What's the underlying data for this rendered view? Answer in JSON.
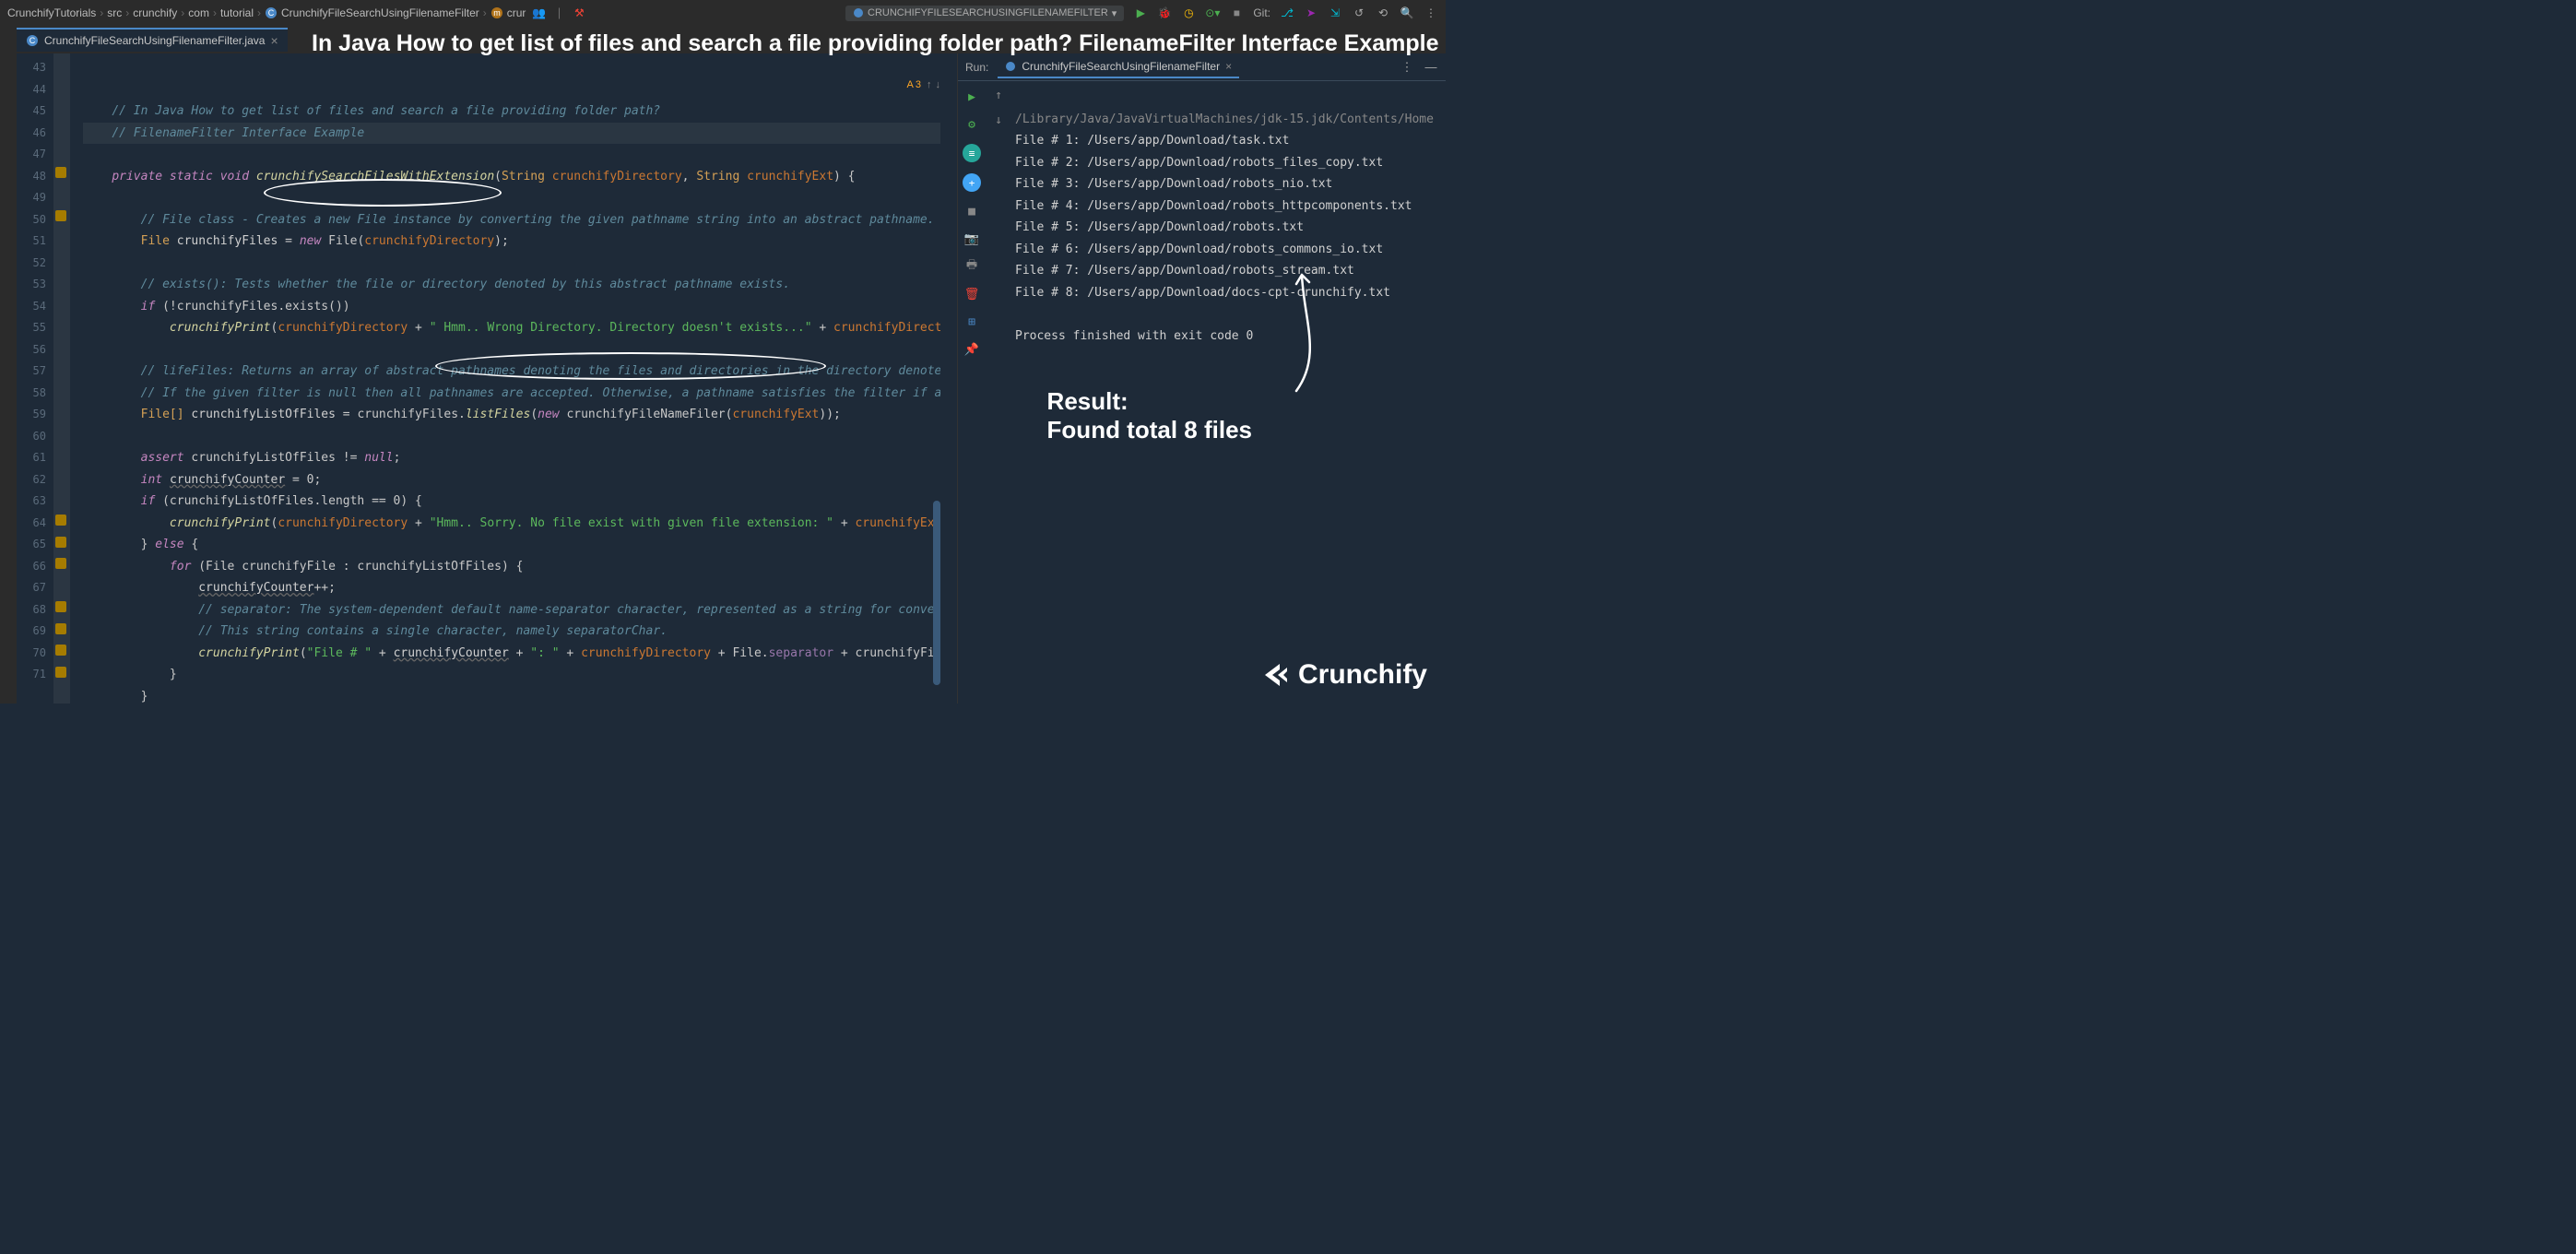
{
  "breadcrumb": [
    "CrunchifyTutorials",
    "src",
    "crunchify",
    "com",
    "tutorial",
    "CrunchifyFileSearchUsingFilenameFilter",
    "crur"
  ],
  "run_config_label": "CRUNCHIFYFILESEARCHUSINGFILENAMEFILTER",
  "git_label": "Git:",
  "tab": {
    "name": "CrunchifyFileSearchUsingFilenameFilter.java"
  },
  "title_overlay": "In Java How to get list of files and search a file providing folder path? FilenameFilter Interface Example",
  "inspection_count": "3",
  "line_numbers": [
    "43",
    "44",
    "45",
    "46",
    "47",
    "48",
    "49",
    "50",
    "51",
    "52",
    "53",
    "54",
    "55",
    "56",
    "57",
    "58",
    "59",
    "60",
    "61",
    "62",
    "63",
    "64",
    "65",
    "66",
    "67",
    "68",
    "69",
    "70",
    "71"
  ],
  "code": {
    "l44": "// In Java How to get list of files and search a file providing folder path?",
    "l45": "// FilenameFilter Interface Example",
    "l46_kw": "private static void",
    "l46_name": "crunchifySearchFilesWithExtension",
    "l46_p1t": "String",
    "l46_p1": "crunchifyDirectory",
    "l46_p2t": "String",
    "l46_p2": "crunchifyExt",
    "l48": "// File class - Creates a new File instance by converting the given pathname string into an abstract pathname. If",
    "l49_t": "File ",
    "l49_v": "crunchifyFiles",
    "l49_eq": " = ",
    "l49_new": "new",
    "l49_f": " File(",
    "l49_arg": "crunchifyDirectory",
    "l49_end": ");",
    "l51": "// exists(): Tests whether the file or directory denoted by this abstract pathname exists.",
    "l52_if": "if",
    "l52_body": " (!crunchifyFiles.exists())",
    "l53_m": "crunchifyPrint",
    "l53_a1": "crunchifyDirectory",
    "l53_s": "\" Hmm.. Wrong Directory. Directory doesn't exists...\"",
    "l53_a2": "crunchifyDirector",
    "l55": "// lifeFiles: Returns an array of abstract pathnames denoting the files and directories in the directory denoted ",
    "l56": "// If the given filter is null then all pathnames are accepted. Otherwise, a pathname satisfies the filter if and",
    "l57_t": "File[] ",
    "l57_v": "crunchifyListOfFiles",
    "l57_eq": " = crunchifyFiles.",
    "l57_m": "listFiles",
    "l57_new": "new",
    "l57_c": " crunchifyFileNameFiler(",
    "l57_arg": "crunchifyExt",
    "l57_end": "));",
    "l59_kw": "assert",
    "l59_body": " crunchifyListOfFiles != ",
    "l59_null": "null",
    "l60_kw": "int",
    "l60_v": "crunchifyCounter",
    "l60_val": " = 0;",
    "l61_if": "if",
    "l61_body": " (crunchifyListOfFiles.length == 0) {",
    "l62_m": "crunchifyPrint",
    "l62_a1": "crunchifyDirectory",
    "l62_s": "\"Hmm.. Sorry. No file exist with given file extension: \"",
    "l62_a2": "crunchifyExt",
    "l63_else": "} ",
    "l63_kw": "else",
    "l63_end": " {",
    "l64_for": "for",
    "l64_body": " (File crunchifyFile : crunchifyListOfFiles) {",
    "l65_v": "crunchifyCounter",
    "l65_end": "++;",
    "l66": "// separator: The system-dependent default name-separator character, represented as a string for conveni",
    "l67": "// This string contains a single character, namely separatorChar.",
    "l68_m": "crunchifyPrint",
    "l68_s1": "\"File # \"",
    "l68_v": "crunchifyCounter",
    "l68_s2": "\": \"",
    "l68_a": "crunchifyDirectory",
    "l68_f": " + File.",
    "l68_sep": "separator",
    "l68_end": " + crunchifyFile."
  },
  "run": {
    "label": "Run:",
    "tab_name": "CrunchifyFileSearchUsingFilenameFilter",
    "lines": [
      "/Library/Java/JavaVirtualMachines/jdk-15.jdk/Contents/Home",
      "File # 1: /Users/app/Download/task.txt",
      "File # 2: /Users/app/Download/robots_files_copy.txt",
      "File # 3: /Users/app/Download/robots_nio.txt",
      "File # 4: /Users/app/Download/robots_httpcomponents.txt",
      "File # 5: /Users/app/Download/robots.txt",
      "File # 6: /Users/app/Download/robots_commons_io.txt",
      "File # 7: /Users/app/Download/robots_stream.txt",
      "File # 8: /Users/app/Download/docs-cpt-crunchify.txt",
      "",
      "Process finished with exit code 0"
    ]
  },
  "result_overlay": "Result:\nFound total 8 files",
  "logo_text": "Crunchify"
}
